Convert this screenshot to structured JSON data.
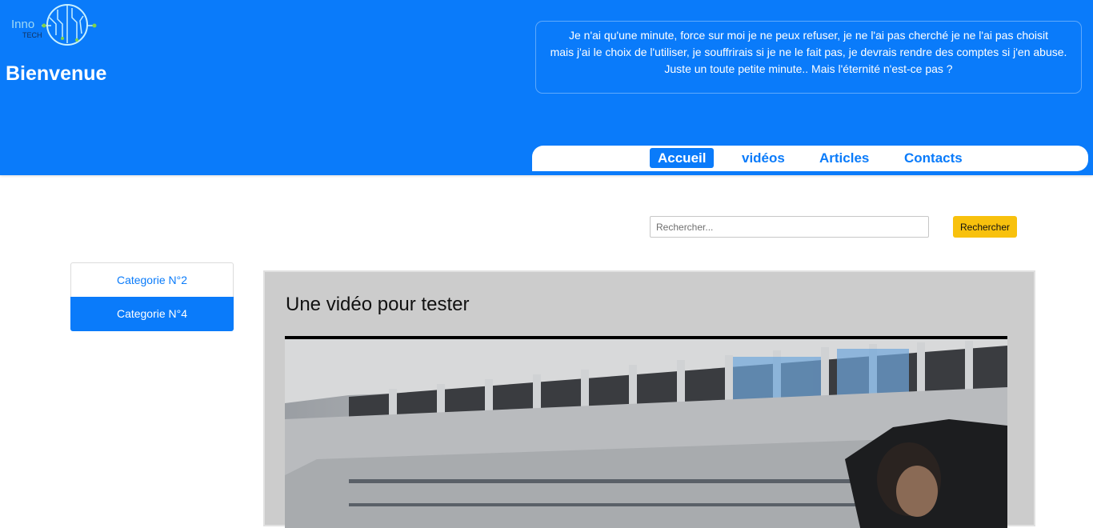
{
  "header": {
    "logo": {
      "line1": "Inno",
      "line2": "TECH",
      "icon": "circuit-globe-logo"
    },
    "welcome": "Bienvenue",
    "quote": {
      "line1": "Je n'ai qu'une minute, force sur moi je ne peux refuser, je ne l'ai pas cherché je ne l'ai pas choisit",
      "line2": "mais j'ai le choix de l'utiliser, je souffrirais si je ne le fait pas, je devrais rendre des comptes si j'en abuse.",
      "line3": "Juste un toute petite minute.. Mais l'éternité n'est-ce pas ?"
    },
    "nav": [
      {
        "label": "Accueil",
        "active": true
      },
      {
        "label": "vidéos",
        "active": false
      },
      {
        "label": "Articles",
        "active": false
      },
      {
        "label": "Contacts",
        "active": false
      }
    ]
  },
  "search": {
    "placeholder": "Rechercher...",
    "value": "",
    "button_label": "Rechercher"
  },
  "sidebar": {
    "categories": [
      {
        "label": "Categorie N°2",
        "active": false
      },
      {
        "label": "Categorie N°4",
        "active": true
      }
    ]
  },
  "main": {
    "title": "Une vidéo pour tester",
    "video": "video-player"
  },
  "colors": {
    "primary": "#0a7bfa",
    "search_button": "#f8c10d",
    "card_background": "#cccccc",
    "white": "#ffffff"
  }
}
